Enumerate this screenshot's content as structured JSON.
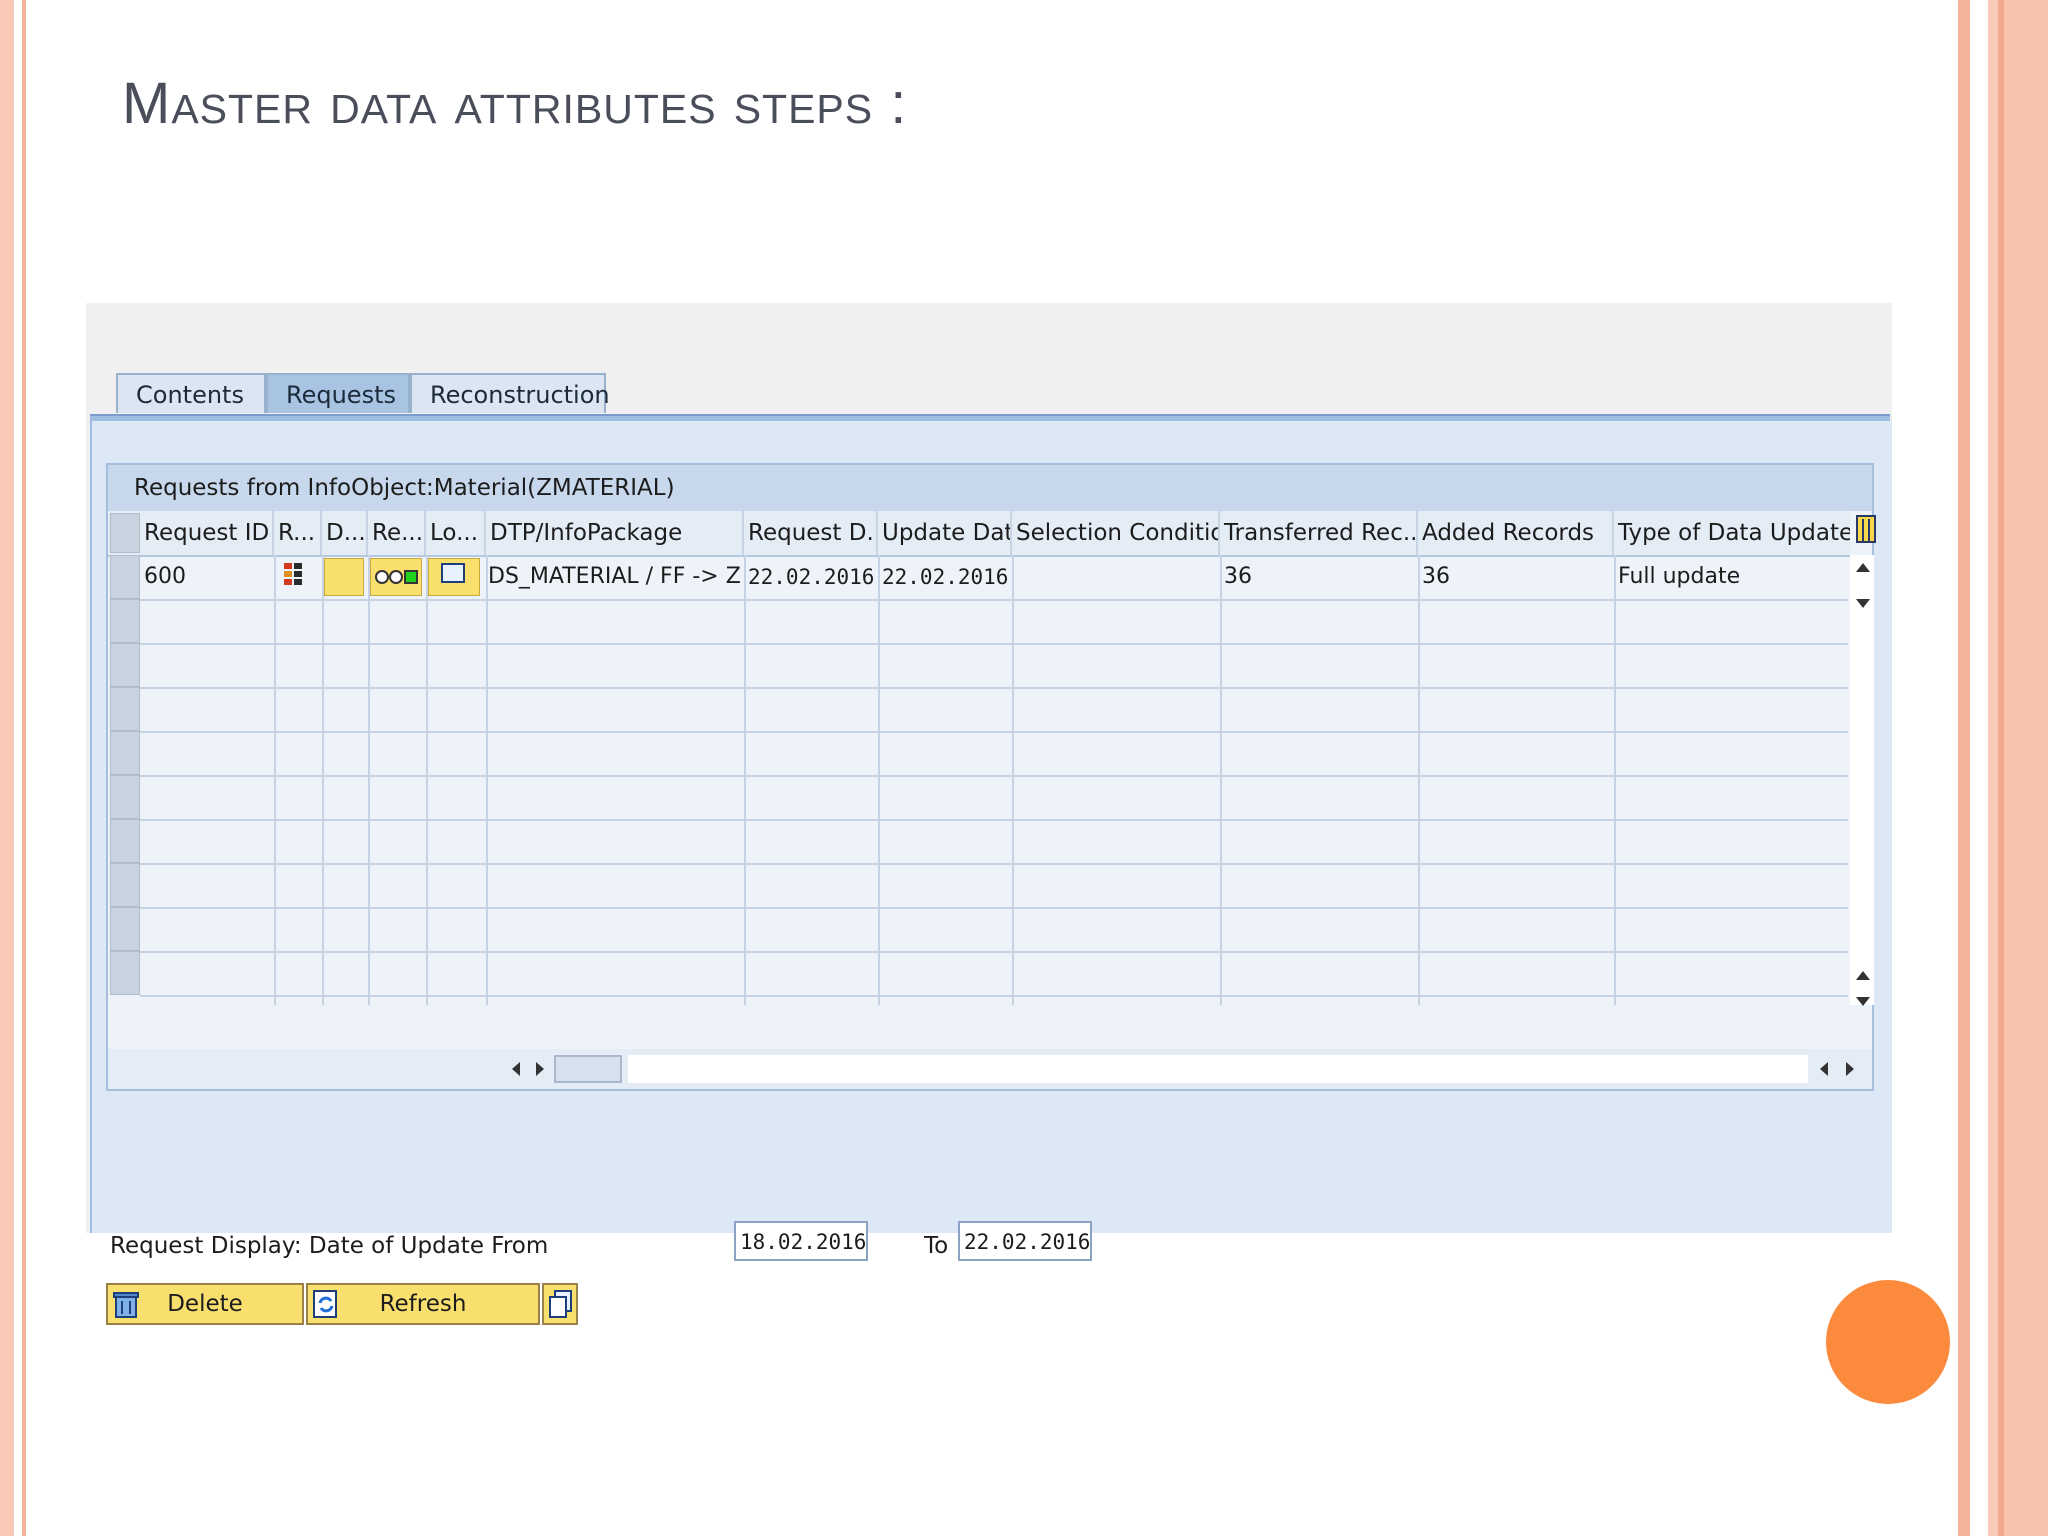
{
  "slide": {
    "title": "Master data attributes steps :",
    "colors": {
      "title": "#4a4e5a",
      "accent_dot": "#fb8a3c",
      "stripe": "#f8c9b4"
    }
  },
  "sap": {
    "tabs": [
      {
        "label": "Contents",
        "active": false
      },
      {
        "label": "Requests",
        "active": true
      },
      {
        "label": "Reconstruction",
        "active": false
      }
    ],
    "grid": {
      "title": "Requests from InfoObject:Material(ZMATERIAL)",
      "columns": [
        "Request ID",
        "R...",
        "D...",
        "Re...",
        "Lo...",
        "DTP/InfoPackage",
        "Request D...",
        "Update Date",
        "Selection Conditions",
        "Transferred Rec...",
        "Added Records",
        "Type of Data Update"
      ],
      "rows": [
        {
          "request_id": "600",
          "dtp_infopackage": "DS_MATERIAL / FF -> Z...",
          "request_date": "22.02.2016",
          "update_date": "22.02.2016",
          "selection_conditions": "",
          "transferred_records": "36",
          "added_records": "36",
          "type_of_data_update": "Full update"
        }
      ],
      "icons": [
        "status-grid-icon",
        "yellow-status-cell",
        "traffic-light-icon",
        "monitor-icon",
        "column-settings-icon"
      ]
    },
    "selection": {
      "label": "Request Display: Date of Update From",
      "from_value": "18.02.2016",
      "to_label": "To",
      "to_value": "22.02.2016"
    },
    "buttons": {
      "delete": "Delete",
      "refresh": "Refresh"
    }
  }
}
